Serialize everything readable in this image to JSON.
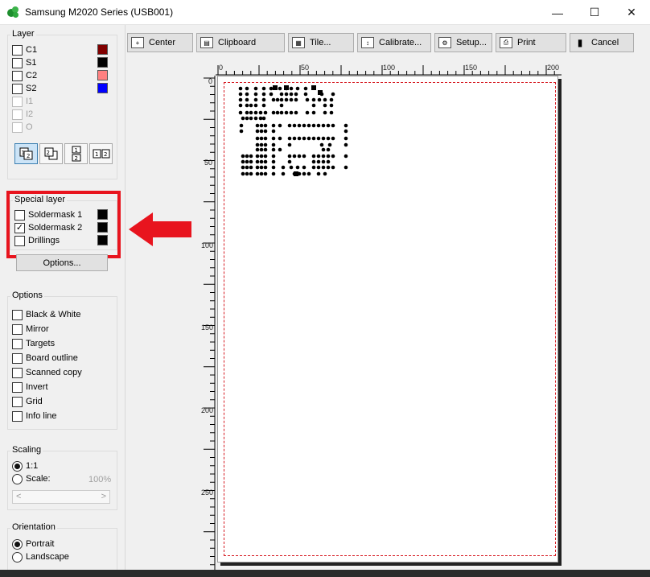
{
  "window": {
    "title": "Samsung M2020 Series (USB001)",
    "controls": {
      "minimize": "—",
      "maximize": "☐",
      "close": "✕"
    }
  },
  "layer": {
    "title": "Layer",
    "items": [
      {
        "label": "C1",
        "checked": false,
        "enabled": true,
        "color": "#800000"
      },
      {
        "label": "S1",
        "checked": false,
        "enabled": true,
        "color": "#000000"
      },
      {
        "label": "C2",
        "checked": false,
        "enabled": true,
        "color": "#ff8080"
      },
      {
        "label": "S2",
        "checked": false,
        "enabled": true,
        "color": "#0000ff"
      },
      {
        "label": "I1",
        "checked": false,
        "enabled": false
      },
      {
        "label": "I2",
        "checked": false,
        "enabled": false
      },
      {
        "label": "O",
        "checked": false,
        "enabled": false
      }
    ],
    "modes": [
      "1|2 overlay",
      "2|1 overlay",
      "1/2 stacked",
      "1|2 side by side"
    ]
  },
  "special_layer": {
    "title": "Special layer",
    "items": [
      {
        "label": "Soldermask 1",
        "checked": false,
        "color": "#000000"
      },
      {
        "label": "Soldermask 2",
        "checked": true,
        "color": "#000000"
      },
      {
        "label": "Drillings",
        "checked": false,
        "color": "#000000"
      }
    ],
    "options_button": "Options..."
  },
  "options": {
    "title": "Options",
    "items": [
      {
        "label": "Black & White",
        "checked": false
      },
      {
        "label": "Mirror",
        "checked": false
      },
      {
        "label": "Targets",
        "checked": false
      },
      {
        "label": "Board outline",
        "checked": false
      },
      {
        "label": "Scanned copy",
        "checked": false
      },
      {
        "label": "Invert",
        "checked": false
      },
      {
        "label": "Grid",
        "checked": false
      },
      {
        "label": "Info line",
        "checked": false
      }
    ]
  },
  "scaling": {
    "title": "Scaling",
    "option_1to1": "1:1",
    "option_scale": "Scale:",
    "scale_value": "100%",
    "selected": "1:1",
    "scroll_left": "<",
    "scroll_right": ">"
  },
  "orientation": {
    "title": "Orientation",
    "portrait": "Portrait",
    "landscape": "Landscape",
    "selected": "Portrait"
  },
  "toolbar": {
    "center": "Center",
    "clipboard": "Clipboard",
    "tile": "Tile...",
    "calibrate": "Calibrate...",
    "setup": "Setup...",
    "print": "Print",
    "cancel": "Cancel"
  },
  "help_label": "?",
  "ruler": {
    "x_ticks": [
      "0",
      "50",
      "100",
      "150",
      "200"
    ],
    "y_ticks": [
      "0",
      "50",
      "100",
      "150",
      "200",
      "250"
    ]
  },
  "colors": {
    "highlight": "#e8141e",
    "page_border": "#d61b22"
  }
}
